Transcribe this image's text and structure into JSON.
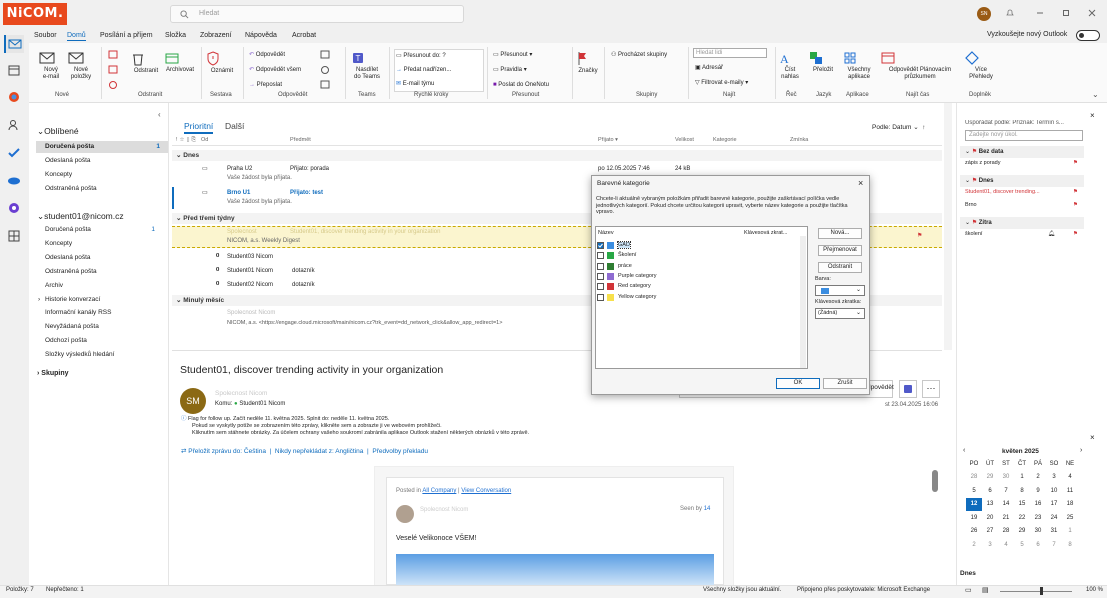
{
  "app": {
    "logo": "NiCOM.",
    "search_placeholder": "Hledat",
    "avatar_initials": "SN"
  },
  "menu": {
    "items": [
      "Soubor",
      "Domů",
      "Posílání a příjem",
      "Složka",
      "Zobrazení",
      "Nápověda",
      "Acrobat"
    ],
    "active": 1,
    "try_new": "Vyzkoušejte nový Outlook"
  },
  "ribbon": {
    "new_email": "Nový\ne-mail",
    "new_items": "Nové\npoložky",
    "delete": "Odstranit",
    "archive": "Archivovat",
    "report": "Oznámit",
    "reply": "Odpovědět",
    "reply_all": "Odpovědět všem",
    "forward": "Přeposlat",
    "teams": "Nasdílet\ndo Teams",
    "move_to": "Přesunout do: ?",
    "forward_manager": "Předat nadřízen...",
    "team_email": "E-mail týmu",
    "move": "Přesunout",
    "rules": "Pravidla",
    "onenote": "Poslat do OneNotu",
    "flags": "Značky",
    "browse_groups": "Procházet skupiny",
    "search_people": "Hledat lidi",
    "address_book": "Adresář",
    "filter_email": "Filtrovat e-maily",
    "read_aloud": "Číst\nnahlas",
    "translate": "Přeložit",
    "all_apps": "Všechny\naplikace",
    "reply_schedule": "Odpovědět Plánovacím\nprůzkumem",
    "insights": "Více\nPřehledy",
    "groups": [
      "Nové",
      "Odstranit",
      "Sestava",
      "Odpovědět",
      "Teams",
      "Rychlé kroky",
      "Přesunout",
      "Skupiny",
      "Najít",
      "Řeč",
      "Jazyk",
      "Aplikace",
      "Najít čas",
      "Doplněk"
    ]
  },
  "folders": {
    "favorites_header": "Oblíbené",
    "favorites": [
      {
        "name": "Doručená pošta",
        "count": "1"
      },
      {
        "name": "Odeslaná pošta",
        "count": ""
      },
      {
        "name": "Koncepty",
        "count": ""
      },
      {
        "name": "Odstraněná pošta",
        "count": ""
      }
    ],
    "account": "student01@nicom.cz",
    "account_folders": [
      {
        "name": "Doručená pošta",
        "count": "1"
      },
      {
        "name": "Koncepty",
        "count": ""
      },
      {
        "name": "Odeslaná pošta",
        "count": ""
      },
      {
        "name": "Odstraněná pošta",
        "count": ""
      },
      {
        "name": "Archiv",
        "count": ""
      },
      {
        "name": "Historie konverzací",
        "count": ""
      },
      {
        "name": "Informační kanály RSS",
        "count": ""
      },
      {
        "name": "Nevyžádaná pošta",
        "count": ""
      },
      {
        "name": "Odchozí pošta",
        "count": ""
      },
      {
        "name": "Složky výsledků hledání",
        "count": ""
      }
    ],
    "groups_header": "Skupiny"
  },
  "list": {
    "tab_focused": "Prioritní",
    "tab_other": "Další",
    "sort": "Podle: Datum",
    "columns": [
      "Od",
      "Předmět",
      "Přijato",
      "Velikost",
      "Kategorie",
      "Zmínka"
    ],
    "group_today": "Dnes",
    "group_three_weeks": "Před třemi týdny",
    "group_last_month": "Minulý měsíc",
    "rows": [
      {
        "from": "Praha U2",
        "subject": "Přijato: porada",
        "preview": "Vaše žádost byla přijata.",
        "received": "po 12.05.2025 7:46",
        "size": "24 kB"
      },
      {
        "from": "Brno U1",
        "subject": "Přijato: test",
        "preview": "Vaše žádost byla přijata."
      },
      {
        "from": "Spolecnost",
        "subject": "Student01, discover trending activity in your organization",
        "preview": "NICOM, a.s. Weekly Digest"
      },
      {
        "from": "Student03 Nicom",
        "subject": ""
      },
      {
        "from": "Student01 Nicom",
        "subject": "dotazník"
      },
      {
        "from": "Student02 Nicom",
        "subject": "dotazník"
      },
      {
        "from": "Spolecnost Nicom",
        "subject": "",
        "preview": "NICOM, a.s. <https://engage.cloud.microsoft/main/nicom.cz?trk_event=dd_network_click&allow_app_redirect=1>"
      }
    ]
  },
  "reading": {
    "subject": "Student01, discover trending activity in your organization",
    "avatar": "SM",
    "sender": "Spolecnost Nicom",
    "to_label": "Komu:",
    "to": "Student01 Nicom",
    "date": "st 23.04.2025 16:06",
    "reply_btn": "Odpovědět",
    "info1": "Flag for follow up. Začít neděle 11. května 2025. Splnit do: neděle 11. května 2025.",
    "info2": "Pokud se vyskytly potíže se zobrazením této zprávy, klikněte sem a zobrazte ji ve webovém prohlížeči.",
    "info3": "Kliknutím sem stáhnete obrázky. Za účelem ochrany vašeho soukromí zabránila aplikace Outlook stažení některých obrázků v této zprávě.",
    "translate_link": "Přeložit zprávu do: Čeština",
    "never_translate": "Nikdy nepřekládat z: Angličtina",
    "translate_prefs": "Předvolby překladu",
    "posted_in": "Posted in",
    "company": "All Company",
    "view_conv": "View Conversation",
    "poster": "Spolecnost Nicom",
    "seen_by": "Seen by",
    "seen_count": "14",
    "greeting": "Veselé Velikonoce VŠEM!"
  },
  "dialog": {
    "title": "Barevné kategorie",
    "text": "Chcete-li aktuálně vybraným položkám přiřadit barevné kategorie, použijte zaškrtávací políčka vedle jednotlivých kategorií. Pokud chcete určitou kategorii upravit, vyberte název kategorie a použijte tlačítka vpravo.",
    "col_name": "Název",
    "col_shortcut": "Klávesová zkrat...",
    "categories": [
      {
        "name": "GAD",
        "color": "#3b8de0",
        "checked": true
      },
      {
        "name": "Školení",
        "color": "#28a745",
        "checked": false
      },
      {
        "name": "práce",
        "color": "#2e7d32",
        "checked": false
      },
      {
        "name": "Purple category",
        "color": "#8e6bd1",
        "checked": false
      },
      {
        "name": "Red category",
        "color": "#d13438",
        "checked": false
      },
      {
        "name": "Yellow category",
        "color": "#f7e04b",
        "checked": false
      }
    ],
    "btn_new": "Nová...",
    "btn_rename": "Přejmenovat",
    "btn_delete": "Odstranit",
    "color_label": "Barva:",
    "shortcut_label": "Klávesová zkratka:",
    "shortcut_value": "(Žádná)",
    "ok": "OK",
    "cancel": "Zrušit"
  },
  "todo": {
    "arrange": "Uspořádat podle: Příznak: Termín s...",
    "new_task": "Zadejte nový úkol.",
    "groups": [
      {
        "name": "Bez data",
        "items": [
          "zápis z porady"
        ]
      },
      {
        "name": "Dnes",
        "items": [
          "Student01, discover trending...",
          "Brno"
        ]
      },
      {
        "name": "Zítra",
        "items": [
          "školení"
        ]
      }
    ]
  },
  "calendar": {
    "month": "květen 2025",
    "weekdays": [
      "PO",
      "ÚT",
      "ST",
      "ČT",
      "PÁ",
      "SO",
      "NE"
    ],
    "weeks": [
      [
        "28",
        "29",
        "30",
        "1",
        "2",
        "3",
        "4"
      ],
      [
        "5",
        "6",
        "7",
        "8",
        "9",
        "10",
        "11"
      ],
      [
        "12",
        "13",
        "14",
        "15",
        "16",
        "17",
        "18"
      ],
      [
        "19",
        "20",
        "21",
        "22",
        "23",
        "24",
        "25"
      ],
      [
        "26",
        "27",
        "28",
        "29",
        "30",
        "31",
        "1"
      ],
      [
        "2",
        "3",
        "4",
        "5",
        "6",
        "7",
        "8"
      ]
    ],
    "today": "12",
    "agenda": "Dnes"
  },
  "status": {
    "items": "Položky: 7",
    "unread": "Nepřečteno: 1",
    "sync": "Všechny složky jsou aktuální.",
    "connection": "Připojeno přes poskytovatele: Microsoft Exchange",
    "zoom": "100 %"
  }
}
